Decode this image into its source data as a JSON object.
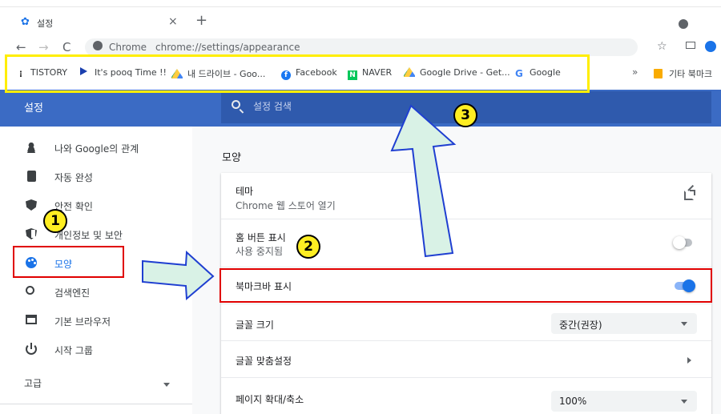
{
  "tab": {
    "title": "설정",
    "close": "×",
    "new_tab": "+"
  },
  "toolbar": {
    "back": "←",
    "forward": "→",
    "reload": "C",
    "site_name": "Chrome",
    "url": "chrome://settings/appearance",
    "bookmark_star": "☆"
  },
  "bookmarks": {
    "items": [
      {
        "label": "TISTORY",
        "icon": "tistory-icon"
      },
      {
        "label": "It's pooq Time !!",
        "icon": "pooq-icon"
      },
      {
        "label": "내 드라이브 - Goo...",
        "icon": "google-drive-icon"
      },
      {
        "label": "Facebook",
        "icon": "facebook-icon"
      },
      {
        "label": "NAVER",
        "icon": "naver-icon"
      },
      {
        "label": "Google Drive - Get...",
        "icon": "google-drive-icon"
      },
      {
        "label": "Google",
        "icon": "google-icon"
      }
    ],
    "more": "»",
    "other_folder": "기타 북마크"
  },
  "header": {
    "title": "설정",
    "search_placeholder": "설정 검색"
  },
  "sidebar": {
    "items": [
      {
        "label": "나와 Google의 관계",
        "icon": "person-icon"
      },
      {
        "label": "자동 완성",
        "icon": "clipboard-icon"
      },
      {
        "label": "안전 확인",
        "icon": "shield-check-icon"
      },
      {
        "label": "개인정보 및 보안",
        "icon": "shield-icon"
      },
      {
        "label": "모양",
        "icon": "palette-icon",
        "active": true
      },
      {
        "label": "검색엔진",
        "icon": "search-icon"
      },
      {
        "label": "기본 브라우저",
        "icon": "browser-window-icon"
      },
      {
        "label": "시작 그룹",
        "icon": "power-icon"
      }
    ],
    "advanced": "고급"
  },
  "main": {
    "section_title": "모양",
    "rows": {
      "theme": {
        "title": "테마",
        "subtitle": "Chrome 웹 스토어 열기"
      },
      "home_button": {
        "title": "홈 버튼 표시",
        "subtitle": "사용 중지됨",
        "enabled": false
      },
      "bookmarks_bar": {
        "title": "북마크바 표시",
        "enabled": true
      },
      "font_size": {
        "title": "글꼴 크기",
        "value": "중간(권장)"
      },
      "custom_fonts": {
        "title": "글꼴 맞춤설정"
      },
      "page_zoom": {
        "title": "페이지 확대/축소",
        "value": "100%"
      }
    }
  },
  "annotations": {
    "badges": [
      "1",
      "2",
      "3"
    ],
    "highlight_bookmarks_color": "#ffee00",
    "highlight_color": "#e00000",
    "arrow_fill": "#d9f2e6",
    "arrow_stroke": "#1f3fd1"
  },
  "colors": {
    "header_blue": "#3b6bc4",
    "accent": "#1a73e8"
  }
}
